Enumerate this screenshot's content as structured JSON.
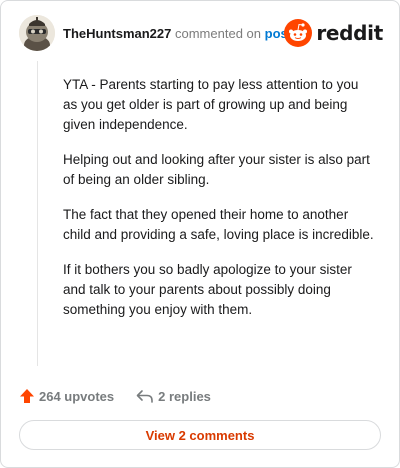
{
  "comment": {
    "author": "TheHuntsman227",
    "action_text": "commented on",
    "target_link": "post",
    "avatar_icon": "snoo-avatar-icon",
    "paragraphs": [
      "YTA - Parents starting to pay less attention to you as you get older is part of growing up and being given independence.",
      "Helping out and looking after your sister is also part of being an older sibling.",
      "The fact that they opened their home to another child and providing a safe, loving place is incredible.",
      "If it bothers you so badly apologize to your sister and talk to your parents about possibly doing something you enjoy with them."
    ]
  },
  "brand": {
    "wordmark": "reddit",
    "logo_icon": "reddit-logo-icon",
    "accent": "#ff4500"
  },
  "actions": {
    "upvotes_label": "264 upvotes",
    "upvote_icon": "upvote-arrow-icon",
    "replies_label": "2 replies",
    "reply_icon": "reply-icon"
  },
  "footer": {
    "view_comments_label": "View 2 comments"
  },
  "colors": {
    "link": "#0079d3",
    "upvote": "#ff4500",
    "view_button_text": "#d93a00"
  }
}
